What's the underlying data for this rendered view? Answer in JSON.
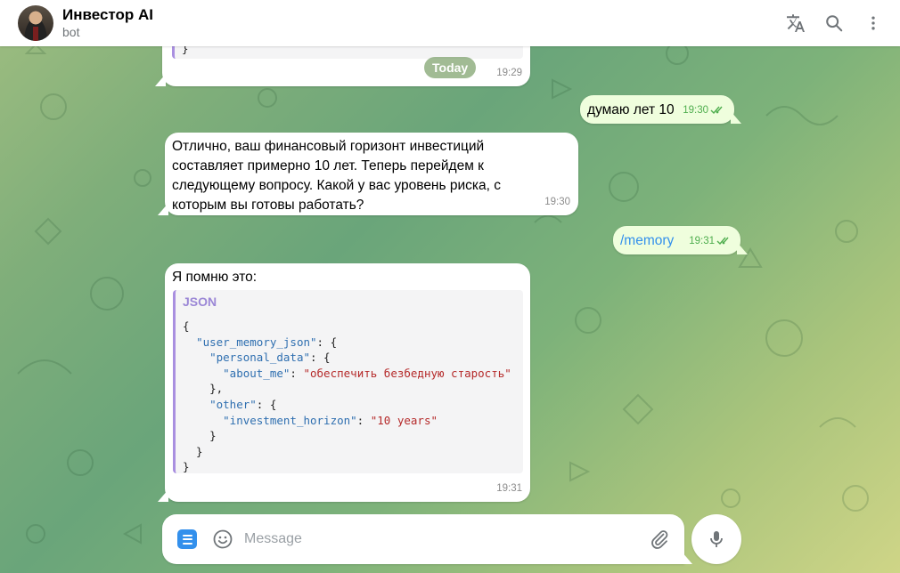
{
  "header": {
    "title": "Инвестор AI",
    "subtitle": "bot"
  },
  "date_chip": "Today",
  "messages": {
    "m0": {
      "code_tail": "}",
      "time": "19:29"
    },
    "m1": {
      "text": "думаю лет 10",
      "time": "19:30"
    },
    "m2": {
      "lines": [
        "Отлично, ваш финансовый горизонт инвестиций",
        "составляет примерно 10 лет. Теперь перейдем к",
        "следующему вопросу. Какой у вас уровень риска, с",
        "которым вы готовы работать?"
      ],
      "time": "19:30"
    },
    "m3": {
      "text": "/memory",
      "time": "19:31"
    },
    "m4": {
      "intro": "Я помню это:",
      "code_lang": "JSON",
      "code": {
        "open": "{",
        "key_user_memory": "\"user_memory_json\"",
        "key_personal_data": "\"personal_data\"",
        "key_about_me": "\"about_me\"",
        "val_about_me": "\"обеспечить безбедную старость\"",
        "key_other": "\"other\"",
        "key_investment_horizon": "\"investment_horizon\"",
        "val_investment_horizon": "\"10 years\"",
        "close": "}"
      },
      "time": "19:31"
    }
  },
  "composer": {
    "placeholder": "Message"
  },
  "colors": {
    "accent": "#3390ec",
    "outgoing_bubble": "#effedd",
    "check_marks": "#4fae4e",
    "code_border": "#a98fe0"
  },
  "icons": [
    "translate-icon",
    "search-icon",
    "more-vertical-icon",
    "menu-icon",
    "emoji-icon",
    "attach-icon",
    "mic-icon",
    "double-check-icon"
  ]
}
